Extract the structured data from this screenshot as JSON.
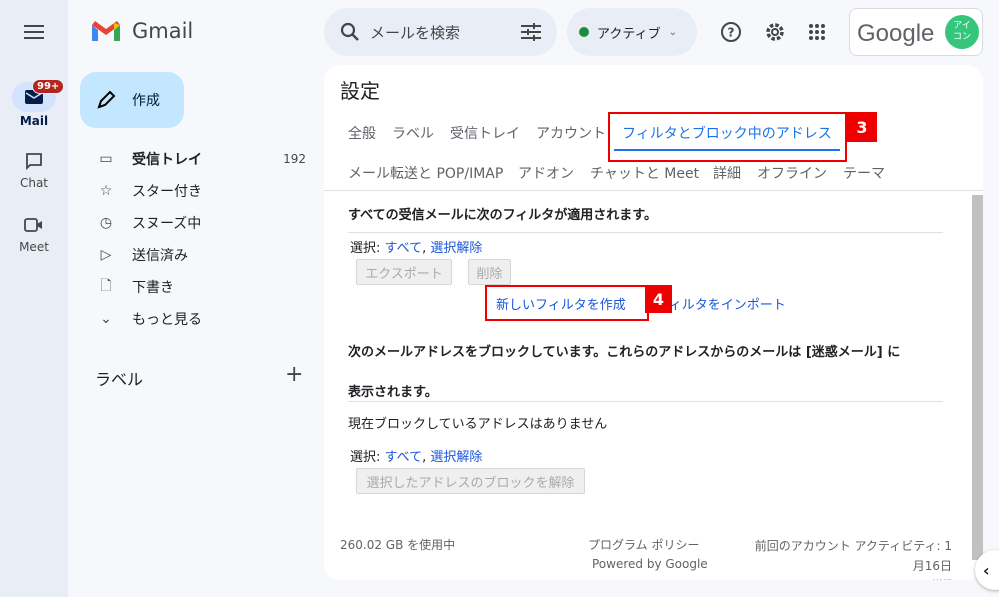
{
  "app": {
    "name": "Gmail"
  },
  "rail": {
    "items": [
      {
        "label": "Mail",
        "badge": "99+"
      },
      {
        "label": "Chat"
      },
      {
        "label": "Meet"
      }
    ]
  },
  "compose": {
    "label": "作成"
  },
  "nav": {
    "items": [
      {
        "label": "受信トレイ",
        "count": "192"
      },
      {
        "label": "スター付き"
      },
      {
        "label": "スヌーズ中"
      },
      {
        "label": "送信済み"
      },
      {
        "label": "下書き"
      },
      {
        "label": "もっと見る"
      }
    ],
    "labels_heading": "ラベル"
  },
  "search": {
    "placeholder": "メールを検索"
  },
  "status": {
    "label": "アクティブ",
    "color": "#1e8e3e"
  },
  "account": {
    "logo_text": "Google",
    "avatar_text": "アイコン",
    "avatar_color": "#34c77b"
  },
  "settings": {
    "title": "設定",
    "tabs_row1": [
      "全般",
      "ラベル",
      "受信トレイ",
      "アカウント",
      "フィルタとブロック中のアドレス"
    ],
    "tabs_row2": [
      "メール転送と POP/IMAP",
      "アドオン",
      "チャットと Meet",
      "詳細",
      "オフライン",
      "テーマ"
    ],
    "filters_heading": "すべての受信メールに次のフィルタが適用されます。",
    "select_label": "選択:",
    "select_all": "すべて",
    "select_none": "選択解除",
    "export_button": "エクスポート",
    "delete_button": "削除",
    "create_filter": "新しいフィルタを作成",
    "import_filter": "フィルタをインポート",
    "blocked_heading_1": "次のメールアドレスをブロックしています。これらのアドレスからのメールは [迷惑メール] に",
    "blocked_heading_2": "表示されます。",
    "no_blocked": "現在ブロックしているアドレスはありません",
    "unblock_button": "選択したアドレスのブロックを解除"
  },
  "footer": {
    "storage": "260.02 GB を使用中",
    "policy": "プログラム ポリシー",
    "powered": "Powered by Google",
    "activity_1": "前回のアカウント アクティビティ: 1",
    "activity_2": "月16日",
    "details": "詳細"
  },
  "annotations": [
    {
      "label": "3"
    },
    {
      "label": "4"
    }
  ],
  "colors": {
    "accent": "#1a73e8",
    "annotation": "#ee0000"
  }
}
